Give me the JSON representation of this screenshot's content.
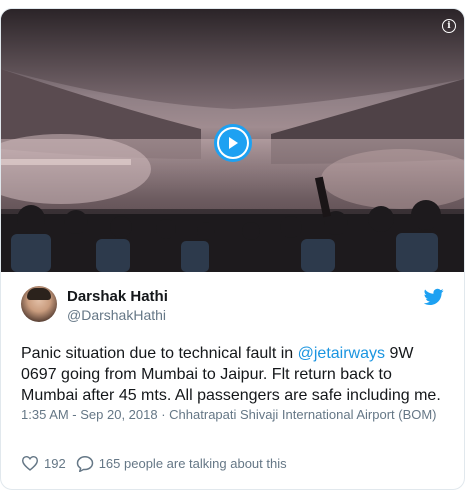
{
  "tweet": {
    "author_name": "Darshak Hathi",
    "author_handle": "@DarshakHathi",
    "text_before_mention": "Panic situation due to technical fault in ",
    "mention": "@jetairways",
    "text_after_mention": " 9W 0697 going from Mumbai to Jaipur.  Flt return back to Mumbai after 45 mts. All passengers are safe including me.",
    "timestamp": "1:35 AM - Sep 20, 2018",
    "separator": " · ",
    "location": "Chhatrapati Shivaji International Airport (BOM)",
    "like_count": "192",
    "talking_text": "165 people are talking about this"
  },
  "icons": {
    "play": "play-icon",
    "info": "info-icon",
    "platform": "bird-icon",
    "like": "heart-icon",
    "reply": "speech-bubble-icon"
  },
  "colors": {
    "accent": "#1da1f2",
    "link": "#1b95e0",
    "text": "#14171a",
    "muted": "#657786"
  }
}
